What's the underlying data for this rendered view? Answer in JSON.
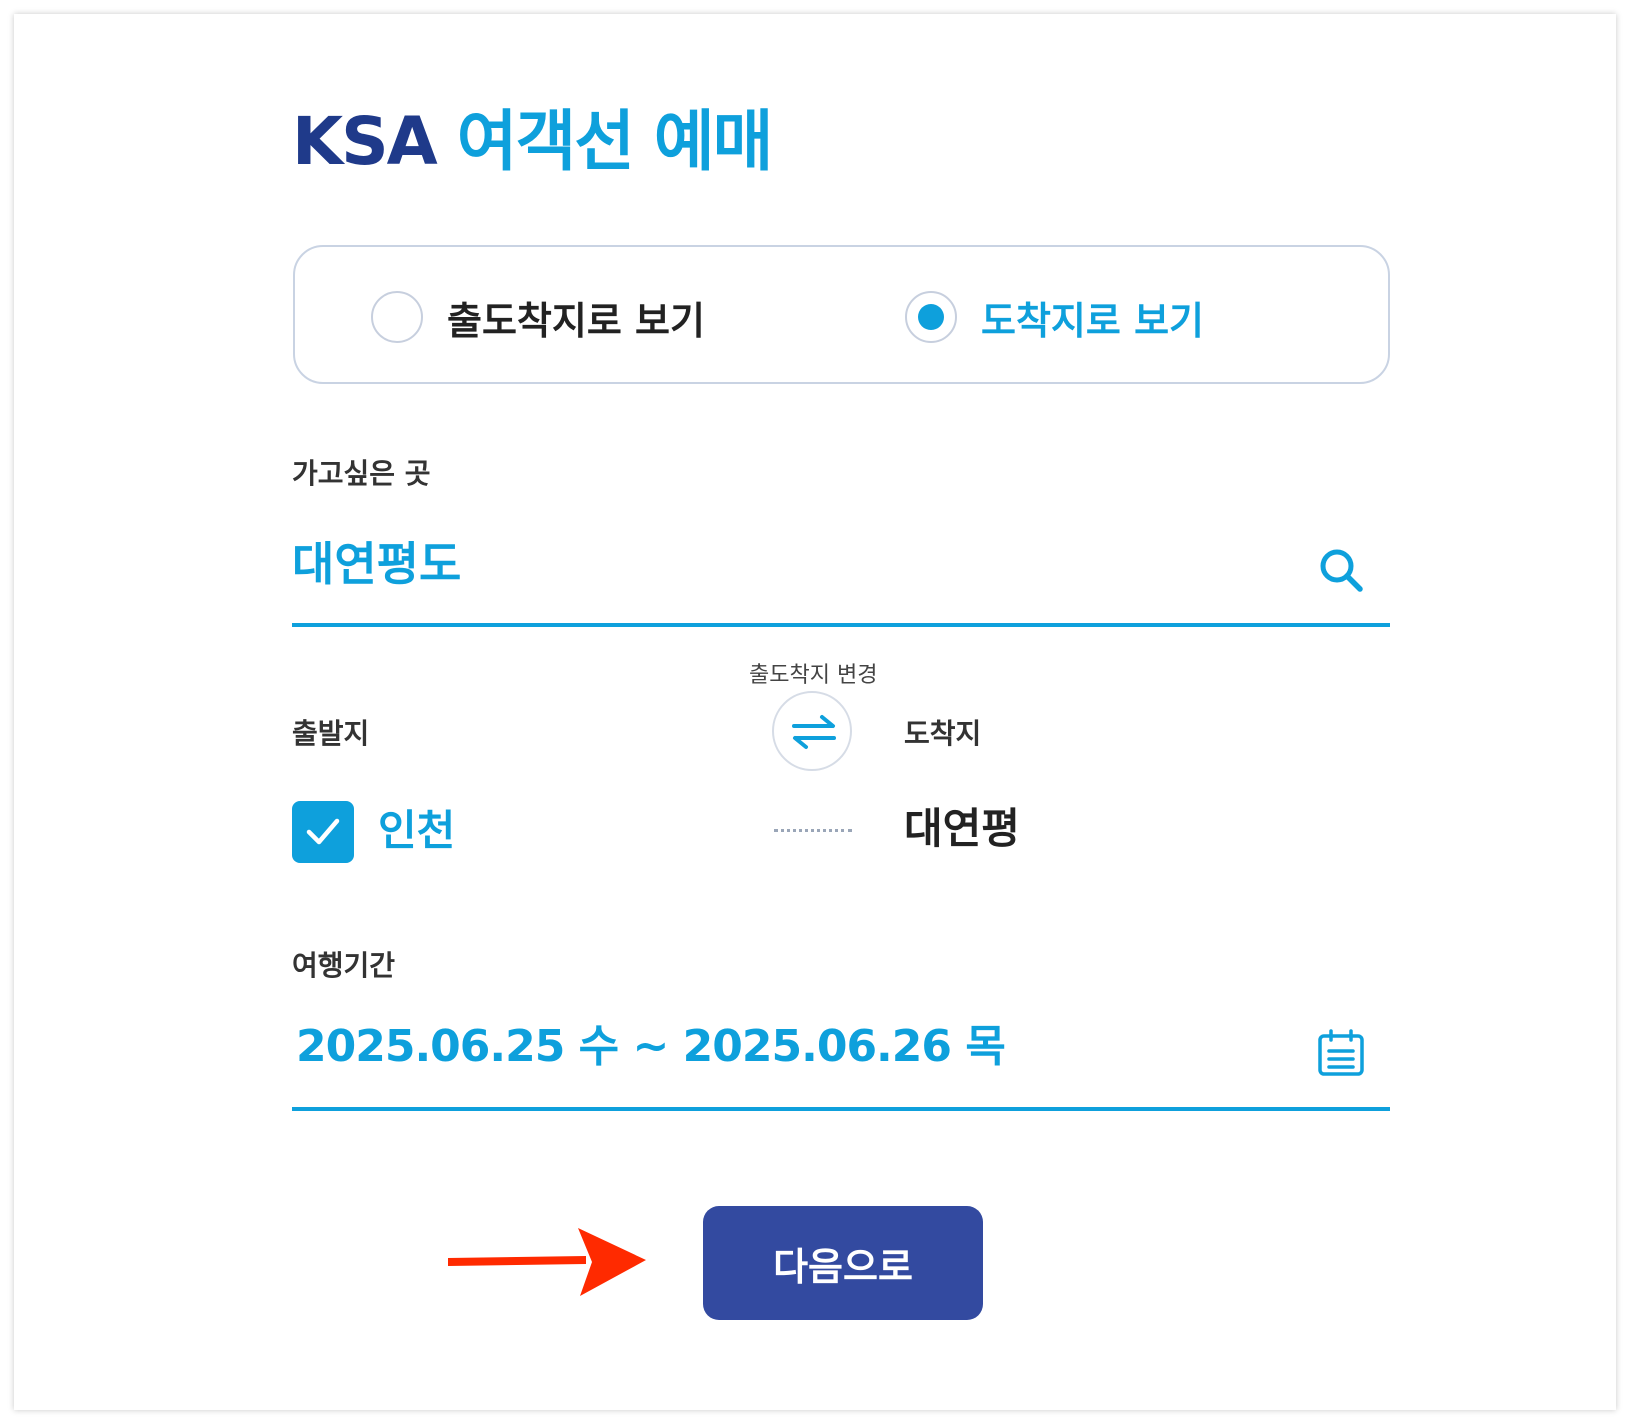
{
  "header": {
    "title_brand": "KSA",
    "title_accent": "여객선 예매"
  },
  "view_mode": {
    "options": [
      {
        "label": "출도착지로 보기",
        "selected": false
      },
      {
        "label": "도착지로 보기",
        "selected": true
      }
    ]
  },
  "destination": {
    "label": "가고싶은 곳",
    "value": "대연평도",
    "icon": "search-icon"
  },
  "route": {
    "swap_caption": "출도착지 변경",
    "swap_icon": "swap-arrows-icon",
    "origin_label": "출발지",
    "origin_value": "인천",
    "origin_checked": true,
    "arrival_label": "도착지",
    "arrival_value": "대연평"
  },
  "period": {
    "label": "여행기간",
    "value": "2025.06.25 수 ~ 2025.06.26 목",
    "icon": "calendar-icon"
  },
  "actions": {
    "next_label": "다음으로"
  },
  "annotation": {
    "icon": "red-arrow-icon",
    "color": "#ff2a00"
  },
  "colors": {
    "accent": "#0ea0dc",
    "brand": "#1f3a8a",
    "button": "#334aa0"
  }
}
